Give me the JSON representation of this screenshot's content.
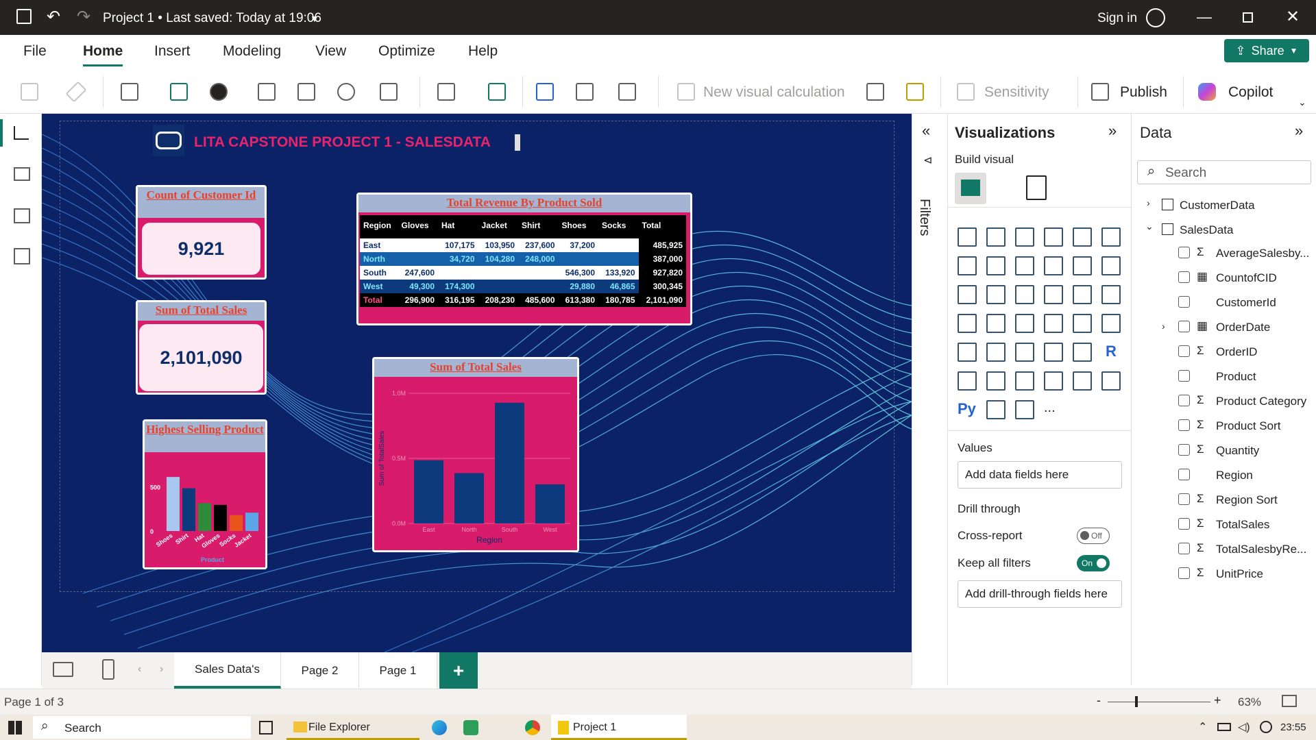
{
  "titlebar": {
    "title": "Project 1 • Last saved: Today at 19:06",
    "signin": "Sign in"
  },
  "menu": {
    "items": [
      "File",
      "Home",
      "Insert",
      "Modeling",
      "View",
      "Optimize",
      "Help"
    ],
    "active": "Home",
    "share": "Share"
  },
  "ribbon": {
    "new_visual_calc": "New visual calculation",
    "sensitivity": "Sensitivity",
    "publish": "Publish",
    "copilot": "Copilot"
  },
  "report": {
    "title": "LITA CAPSTONE PROJECT 1 - SALESDATA",
    "card1": {
      "title": "Count of Customer Id",
      "value": "9,921"
    },
    "card2": {
      "title": "Sum of Total Sales",
      "value": "2,101,090"
    },
    "card3": {
      "title": "Highest Selling Product"
    },
    "matrix": {
      "title": "Total Revenue By Product Sold",
      "headers": [
        "Region",
        "Gloves",
        "Hat",
        "Jacket",
        "Shirt",
        "Shoes",
        "Socks",
        "Total"
      ],
      "rows": [
        [
          "East",
          "",
          "107,175",
          "103,950",
          "237,600",
          "37,200",
          "",
          "485,925"
        ],
        [
          "North",
          "",
          "34,720",
          "104,280",
          "248,000",
          "",
          "",
          "387,000"
        ],
        [
          "South",
          "247,600",
          "",
          "",
          "",
          "546,300",
          "133,920",
          "927,820"
        ],
        [
          "West",
          "49,300",
          "174,300",
          "",
          "",
          "29,880",
          "46,865",
          "300,345"
        ],
        [
          "Total",
          "296,900",
          "316,195",
          "208,230",
          "485,600",
          "613,380",
          "180,785",
          "2,101,090"
        ]
      ]
    },
    "chart_title": "Sum of Total Sales"
  },
  "chart_data": [
    {
      "type": "bar",
      "title": "Highest Selling Product",
      "xlabel": "Product",
      "ylabel": "",
      "categories": [
        "Shoes",
        "Shirt",
        "Hat",
        "Gloves",
        "Socks",
        "Jacket"
      ],
      "values": [
        613.38,
        485.6,
        316.195,
        296.9,
        180.785,
        208.23
      ],
      "ytick_labels": [
        "0",
        "500"
      ],
      "ylim": [
        0,
        700
      ],
      "colors": [
        "#a9c8f0",
        "#0d3a7d",
        "#2e8b3a",
        "#000000",
        "#e8541c",
        "#5aa6e8"
      ]
    },
    {
      "type": "bar",
      "title": "Sum of Total Sales",
      "xlabel": "Region",
      "ylabel": "Sum of TotalSales",
      "categories": [
        "East",
        "North",
        "South",
        "West"
      ],
      "values": [
        485925,
        387000,
        927820,
        300345
      ],
      "ytick_labels": [
        "0.0M",
        "0.5M",
        "1.0M"
      ],
      "ylim": [
        0,
        1000000
      ],
      "colors": [
        "#0d3a7d"
      ]
    }
  ],
  "filters": {
    "label": "Filters"
  },
  "viz": {
    "title": "Visualizations",
    "build": "Build visual",
    "values": "Values",
    "values_placeholder": "Add data fields here",
    "drill": "Drill through",
    "cross": "Cross-report",
    "cross_state": "Off",
    "keep": "Keep all filters",
    "keep_state": "On",
    "drill_placeholder": "Add drill-through fields here",
    "py_label": "Py",
    "r_label": "R",
    "more": "..."
  },
  "data": {
    "title": "Data",
    "search_placeholder": "Search",
    "tables": [
      "CustomerData",
      "SalesData"
    ],
    "fields": [
      {
        "name": "AverageSalesby...",
        "sigma": true
      },
      {
        "name": "CountofCID",
        "sigma": false,
        "calc": true
      },
      {
        "name": "CustomerId",
        "sigma": false
      },
      {
        "name": "OrderDate",
        "sigma": false,
        "calc": true,
        "expand": true
      },
      {
        "name": "OrderID",
        "sigma": true
      },
      {
        "name": "Product",
        "sigma": false
      },
      {
        "name": "Product Category",
        "sigma": true
      },
      {
        "name": "Product Sort",
        "sigma": true
      },
      {
        "name": "Quantity",
        "sigma": true
      },
      {
        "name": "Region",
        "sigma": false
      },
      {
        "name": "Region Sort",
        "sigma": true
      },
      {
        "name": "TotalSales",
        "sigma": true
      },
      {
        "name": "TotalSalesbyRe...",
        "sigma": true
      },
      {
        "name": "UnitPrice",
        "sigma": true
      }
    ]
  },
  "tabs": {
    "pages": [
      "Sales Data's",
      "Page 2",
      "Page 1"
    ],
    "active": "Sales Data's"
  },
  "status": {
    "page": "Page 1 of 3",
    "zoom": "63%"
  },
  "taskbar": {
    "search": "Search",
    "file_explorer": "File Explorer",
    "project": "Project 1",
    "time": "23:55"
  }
}
